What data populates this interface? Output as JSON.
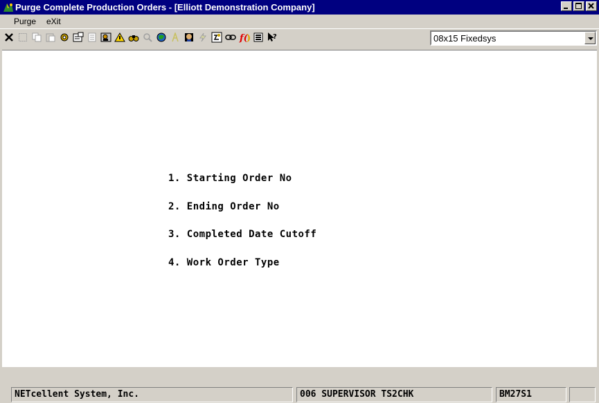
{
  "window": {
    "title": "Purge Complete Production Orders - [Elliott Demonstration Company]",
    "app_icon": "elliott-logo-icon",
    "title_color": "#000080"
  },
  "menubar": {
    "items": [
      {
        "label": "Purge",
        "icon": null
      },
      {
        "label": "eXit",
        "icon": null
      }
    ]
  },
  "toolbar": {
    "icons": [
      "close-x-icon",
      "select-icon",
      "copy-icon",
      "paste-icon",
      "settings-icon",
      "properties-icon",
      "notes-icon",
      "user-card-icon",
      "alert-icon",
      "binoculars-icon",
      "search-icon",
      "globe-icon",
      "font-icon",
      "face-icon",
      "lightning-icon",
      "calculator-icon",
      "link-icon",
      "function-icon",
      "list-icon",
      "help-pointer-icon"
    ],
    "font_select": "08x15 Fixedsys"
  },
  "form": {
    "fields": [
      "1. Starting Order No",
      "2. Ending Order No",
      "3. Completed Date Cutoff",
      "4. Work Order Type"
    ]
  },
  "status": {
    "company": "NETcellent System, Inc.",
    "user": "006 SUPERVISOR TS2CHK",
    "program": "BM27S1"
  }
}
